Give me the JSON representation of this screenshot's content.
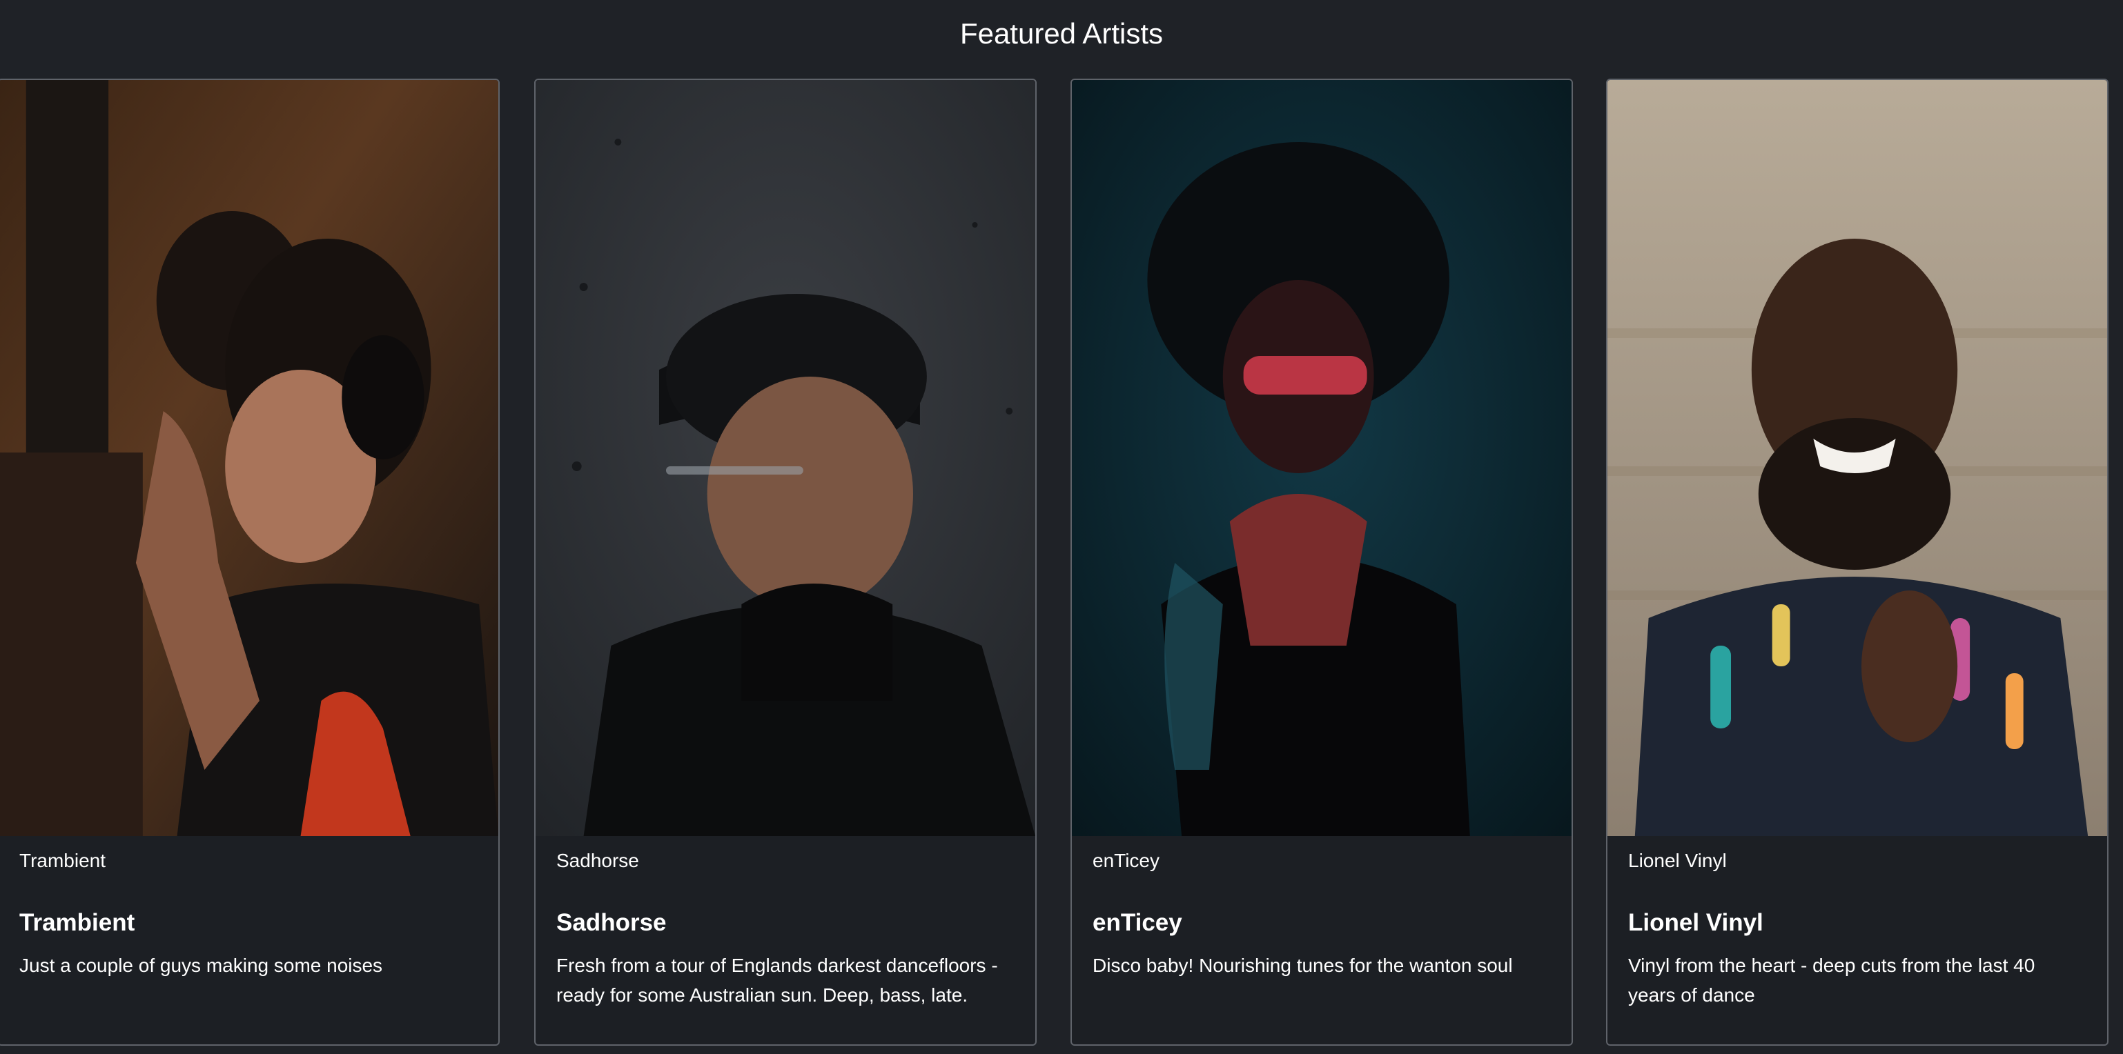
{
  "page": {
    "title": "Featured Artists"
  },
  "artists": [
    {
      "subtitle": "Trambient",
      "name": "Trambient",
      "description": "Just a couple of guys making some noises"
    },
    {
      "subtitle": "Sadhorse",
      "name": "Sadhorse",
      "description": "Fresh from a tour of Englands darkest dancefloors - ready for some Australian sun. Deep, bass, late."
    },
    {
      "subtitle": "enTicey",
      "name": "enTicey",
      "description": "Disco baby! Nourishing tunes for the wanton soul"
    },
    {
      "subtitle": "Lionel Vinyl",
      "name": "Lionel Vinyl",
      "description": "Vinyl from the heart - deep cuts from the last 40 years of dance"
    }
  ],
  "colors": {
    "background": "#1f2227",
    "card_border": "#5f636a",
    "text": "#ffffff"
  }
}
